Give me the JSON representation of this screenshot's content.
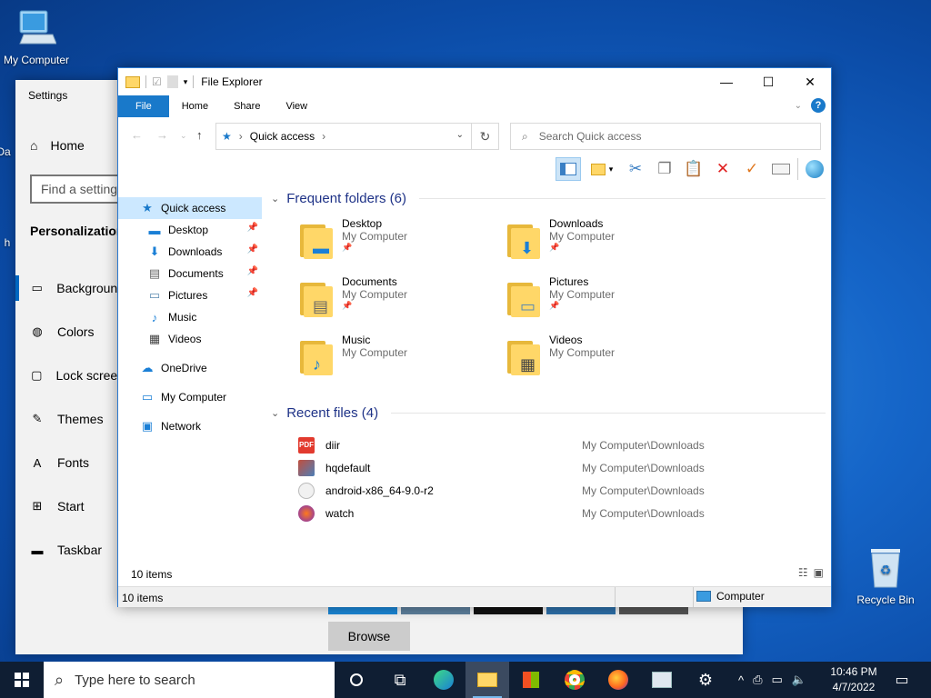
{
  "desktop": {
    "icons": [
      {
        "label": "My Computer",
        "icon": "computer-icon"
      },
      {
        "label": "Recycle Bin",
        "icon": "recycle-bin-icon"
      }
    ],
    "partial_labels": [
      "Da",
      "h"
    ]
  },
  "settings": {
    "title": "Settings",
    "home": "Home",
    "search_placeholder": "Find a setting",
    "section": "Personalization",
    "nav": [
      {
        "label": "Background",
        "icon": "image-icon"
      },
      {
        "label": "Colors",
        "icon": "palette-icon"
      },
      {
        "label": "Lock screen",
        "icon": "lock-screen-icon"
      },
      {
        "label": "Themes",
        "icon": "themes-icon"
      },
      {
        "label": "Fonts",
        "icon": "fonts-icon"
      },
      {
        "label": "Start",
        "icon": "start-icon"
      },
      {
        "label": "Taskbar",
        "icon": "taskbar-icon"
      }
    ],
    "browse_label": "Browse"
  },
  "explorer": {
    "title": "File Explorer",
    "tabs": [
      "File",
      "Home",
      "Share",
      "View"
    ],
    "address": "Quick access",
    "search_placeholder": "Search Quick access",
    "nav": {
      "quick_access": "Quick access",
      "pinned": [
        {
          "label": "Desktop",
          "icon": "desktop-icon",
          "pinned": true
        },
        {
          "label": "Downloads",
          "icon": "download-icon",
          "pinned": true
        },
        {
          "label": "Documents",
          "icon": "document-icon",
          "pinned": true
        },
        {
          "label": "Pictures",
          "icon": "picture-icon",
          "pinned": true
        },
        {
          "label": "Music",
          "icon": "music-icon",
          "pinned": false
        },
        {
          "label": "Videos",
          "icon": "video-icon",
          "pinned": false
        }
      ],
      "onedrive": "OneDrive",
      "my_computer": "My Computer",
      "network": "Network"
    },
    "frequent_header": "Frequent folders (6)",
    "folders": [
      {
        "name": "Desktop",
        "location": "My Computer",
        "pinned": true,
        "badge": "desktop-icon"
      },
      {
        "name": "Downloads",
        "location": "My Computer",
        "pinned": true,
        "badge": "download-icon"
      },
      {
        "name": "Documents",
        "location": "My Computer",
        "pinned": true,
        "badge": "document-icon"
      },
      {
        "name": "Pictures",
        "location": "My Computer",
        "pinned": true,
        "badge": "picture-icon"
      },
      {
        "name": "Music",
        "location": "My Computer",
        "pinned": false,
        "badge": "music-icon"
      },
      {
        "name": "Videos",
        "location": "My Computer",
        "pinned": false,
        "badge": "video-icon"
      }
    ],
    "recent_header": "Recent files (4)",
    "recent_files": [
      {
        "name": "diir",
        "location": "My Computer\\Downloads",
        "icon": "pdf-icon"
      },
      {
        "name": "hqdefault",
        "location": "My Computer\\Downloads",
        "icon": "image-file-icon"
      },
      {
        "name": "android-x86_64-9.0-r2",
        "location": "My Computer\\Downloads",
        "icon": "disc-image-icon"
      },
      {
        "name": "watch",
        "location": "My Computer\\Downloads",
        "icon": "media-file-icon"
      }
    ],
    "item_count": "10 items",
    "status_left": "10 items",
    "status_right": "Computer"
  },
  "taskbar": {
    "search_placeholder": "Type here to search",
    "apps": [
      "cortana-icon",
      "task-view-icon",
      "edge-icon",
      "file-explorer-icon",
      "store-icon",
      "chrome-icon",
      "firefox-icon",
      "app-icon",
      "settings-icon"
    ],
    "time": "10:46 PM",
    "date": "4/7/2022"
  },
  "colors": {
    "accent": "#1979ca",
    "desktop": "#1565c8",
    "taskbar": "#0f1e33",
    "group_header": "#1e3287"
  }
}
